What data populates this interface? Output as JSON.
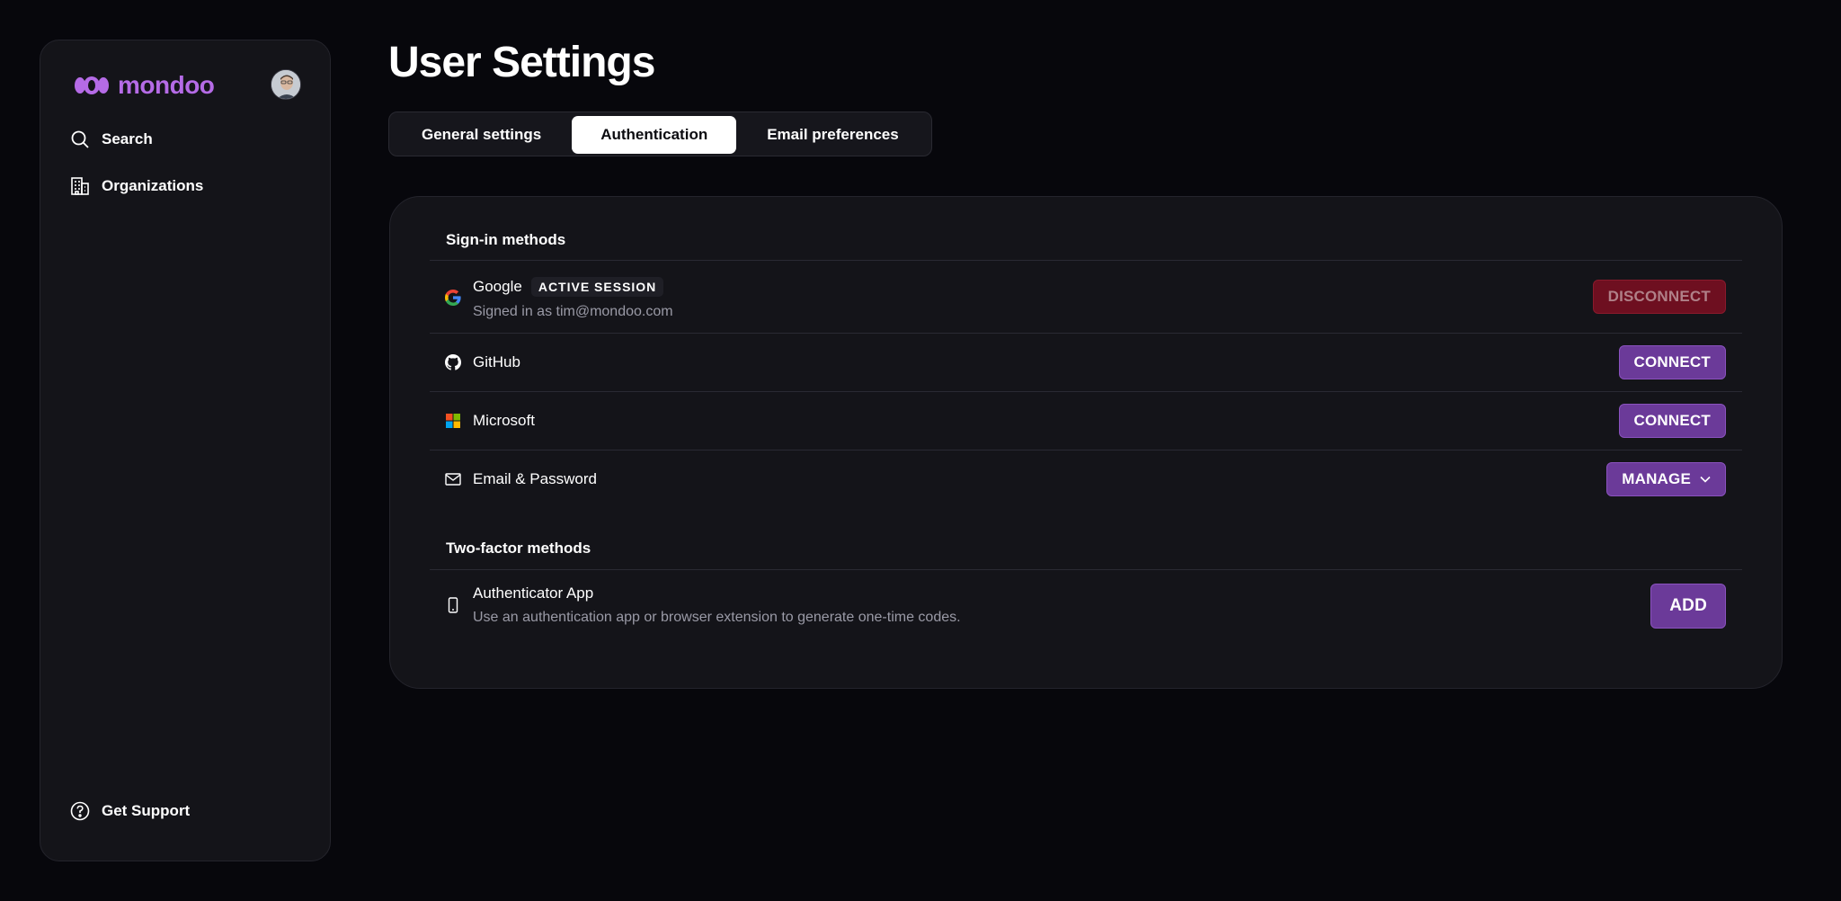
{
  "sidebar": {
    "logo_text": "mondoo",
    "avatar_alt": "",
    "nav": [
      {
        "label": "Search",
        "icon": "search-icon"
      },
      {
        "label": "Organizations",
        "icon": "building-icon"
      }
    ],
    "support": {
      "label": "Get Support",
      "icon": "help-circle-icon"
    }
  },
  "page": {
    "title": "User Settings"
  },
  "tabs": [
    {
      "label": "General settings",
      "active": false
    },
    {
      "label": "Authentication",
      "active": true
    },
    {
      "label": "Email preferences",
      "active": false
    }
  ],
  "sign_in": {
    "title": "Sign-in methods",
    "methods": [
      {
        "name": "Google",
        "badge": "ACTIVE SESSION",
        "sub": "Signed in as tim@mondoo.com",
        "action": "DISCONNECT",
        "icon": "google-icon"
      },
      {
        "name": "GitHub",
        "action": "CONNECT",
        "icon": "github-icon"
      },
      {
        "name": "Microsoft",
        "action": "CONNECT",
        "icon": "microsoft-icon"
      },
      {
        "name": "Email & Password",
        "action": "MANAGE",
        "icon": "mail-icon"
      }
    ]
  },
  "two_factor": {
    "title": "Two-factor methods",
    "methods": [
      {
        "name": "Authenticator App",
        "sub": "Use an authentication app or browser extension to generate one-time codes.",
        "action": "ADD",
        "icon": "phone-icon"
      }
    ]
  },
  "colors": {
    "accent": "#6b3a99",
    "logo": "#b56be6",
    "danger": "#6e0f20",
    "background": "#07070c",
    "panel": "#141419"
  }
}
